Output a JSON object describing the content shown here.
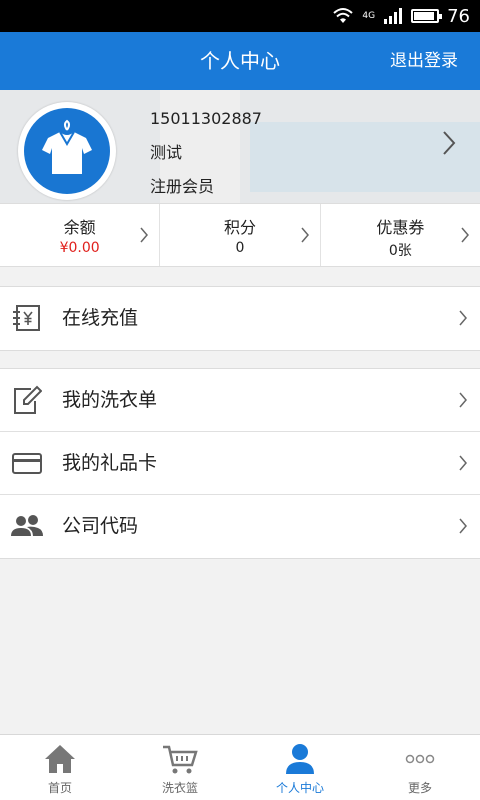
{
  "status": {
    "battery": "76",
    "network": "4G"
  },
  "header": {
    "title": "个人中心",
    "logout": "退出登录"
  },
  "profile": {
    "phone": "15011302887",
    "name": "测试",
    "level": "注册会员"
  },
  "stats": [
    {
      "label": "余额",
      "value": "¥0.00"
    },
    {
      "label": "积分",
      "value": "0"
    },
    {
      "label": "优惠券",
      "value": "0张"
    }
  ],
  "menu": {
    "recharge": "在线充值",
    "orders": "我的洗衣单",
    "giftcard": "我的礼品卡",
    "company": "公司代码"
  },
  "tabs": [
    {
      "label": "首页"
    },
    {
      "label": "洗衣篮"
    },
    {
      "label": "个人中心"
    },
    {
      "label": "更多"
    }
  ],
  "colors": {
    "primary": "#1a7ad8",
    "balance": "#e0201c"
  }
}
